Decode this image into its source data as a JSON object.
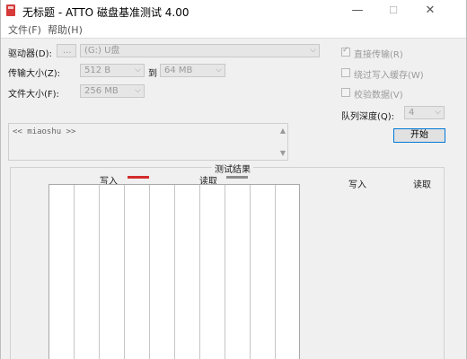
{
  "window": {
    "title": "无标题 - ATTO 磁盘基准测试 4.00",
    "minimize_glyph": "—",
    "maximize_glyph": "☐",
    "close_glyph": "✕"
  },
  "menu": {
    "file": "文件(F)",
    "help": "帮助(H)"
  },
  "settings": {
    "drive_label": "驱动器(D):",
    "drive_browse": "...",
    "drive_value": "(G:) U盘",
    "transfer_label": "传输大小(Z):",
    "transfer_from": "512 B",
    "transfer_to_label": "到",
    "transfer_to": "64 MB",
    "file_size_label": "文件大小(F):",
    "file_size": "256 MB"
  },
  "options": {
    "direct_io": "直接传输(R)",
    "direct_io_checked": true,
    "bypass_write_cache": "绕过写入缓存(W)",
    "bypass_write_cache_checked": false,
    "verify_data": "校验数据(V)",
    "verify_data_checked": false,
    "queue_depth_label": "队列深度(Q):",
    "queue_depth": "4"
  },
  "description": {
    "text": "<< miaoshu >>"
  },
  "start_button": "开始",
  "results": {
    "title": "测试结果",
    "legend_write": "写入",
    "legend_read": "读取",
    "write_color": "#d42c2c",
    "read_color": "#8c8c8c",
    "col_write": "写入",
    "col_read": "读取"
  },
  "colors": {
    "accent": "#0078d7",
    "app_icon": "#d63a3a"
  }
}
